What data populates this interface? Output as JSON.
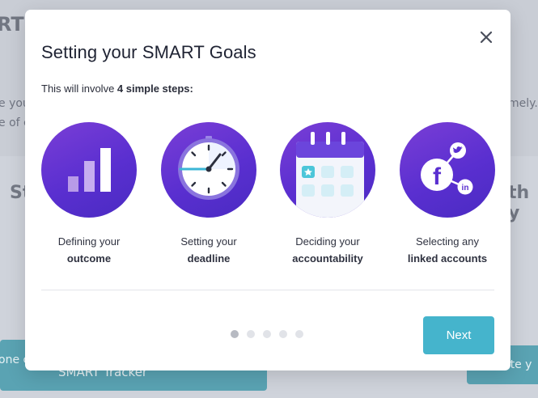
{
  "background": {
    "title_fragment": "RT",
    "line1_fragment": "e you",
    "line2_fragment": "e of c",
    "right_fragment": "mely.",
    "heading_left_fragment": "St",
    "heading_right_fragment": "th y",
    "button_left_line1": "one c",
    "button_left_line2": "SMART Tracker",
    "button_right_fragment": "ate y"
  },
  "modal": {
    "title": "Setting your SMART Goals",
    "intro_prefix": "This will involve ",
    "intro_bold": "4 simple steps:",
    "steps": [
      {
        "icon": "bar-chart-icon",
        "line1": "Defining your",
        "line2": "outcome"
      },
      {
        "icon": "stopwatch-icon",
        "line1": "Setting your",
        "line2": "deadline"
      },
      {
        "icon": "calendar-icon",
        "line1": "Deciding your",
        "line2": "accountability"
      },
      {
        "icon": "social-share-icon",
        "line1": "Selecting any",
        "line2": "linked accounts"
      }
    ],
    "pagination": {
      "total": 5,
      "current": 1
    },
    "next_label": "Next"
  },
  "colors": {
    "accent": "#45b4cc",
    "circle_purple": "#5a2fd0",
    "title_text": "#1f2333"
  }
}
